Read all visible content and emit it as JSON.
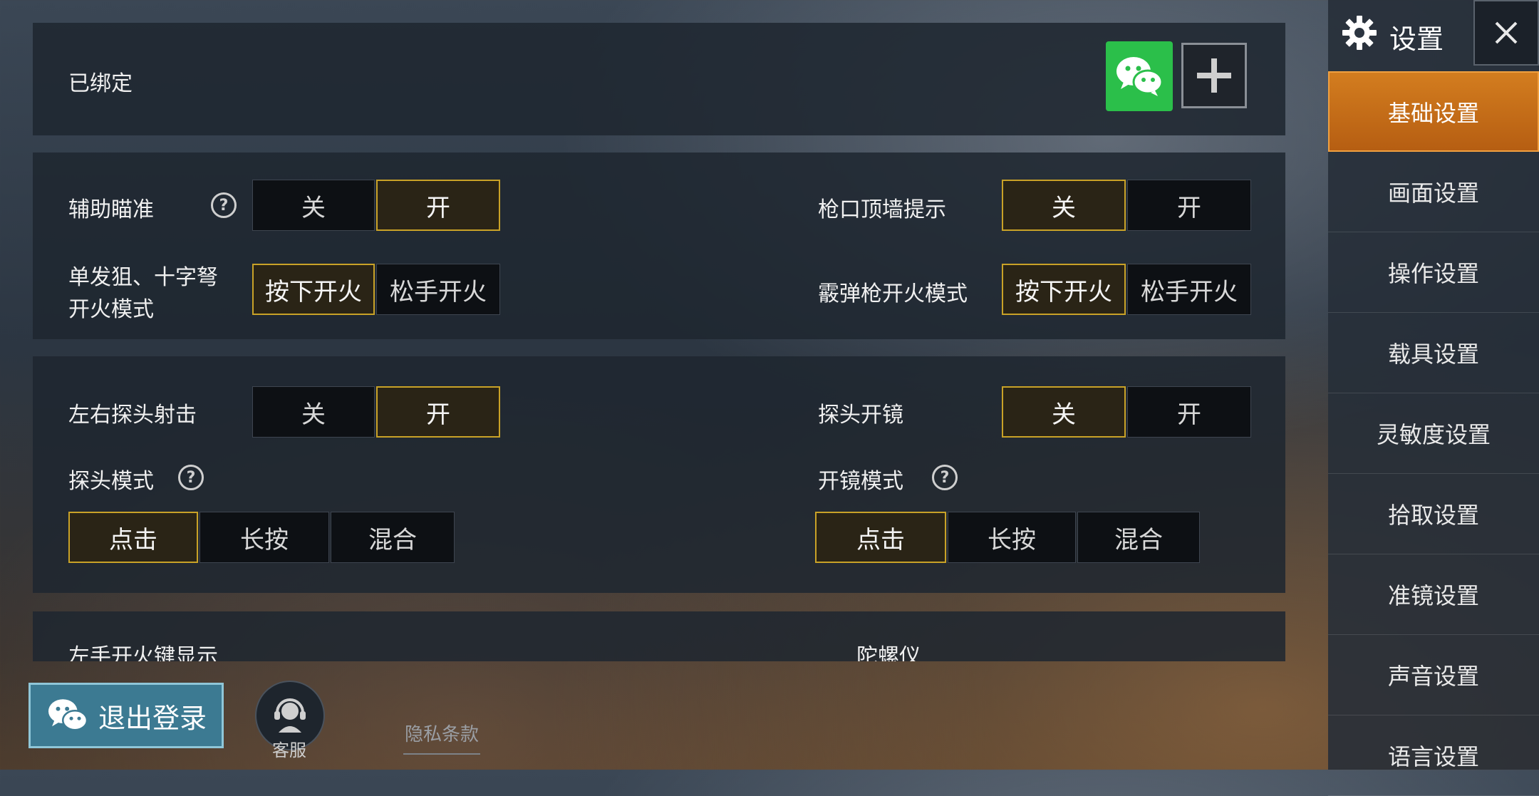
{
  "colors": {
    "accent": "#c9a227",
    "active_tab": "#c46a17",
    "wechat": "#2bbf4a"
  },
  "account": {
    "bound_label": "已绑定",
    "wechat_icon": "wechat-icon",
    "add_icon": "plus-icon"
  },
  "section1": {
    "aim_assist": {
      "label": "辅助瞄准",
      "options": [
        "关",
        "开"
      ],
      "selected": "开"
    },
    "muzzle_wall": {
      "label": "枪口顶墙提示",
      "options": [
        "关",
        "开"
      ],
      "selected": "关"
    },
    "sniper_mode": {
      "label_line1": "单发狙、十字弩",
      "label_line2": "开火模式",
      "options": [
        "按下开火",
        "松手开火"
      ],
      "selected": "按下开火"
    },
    "shotgun_mode": {
      "label": "霰弹枪开火模式",
      "options": [
        "按下开火",
        "松手开火"
      ],
      "selected": "按下开火"
    }
  },
  "section2": {
    "lean_fire": {
      "label": "左右探头射击",
      "options": [
        "关",
        "开"
      ],
      "selected": "开"
    },
    "lean_scope": {
      "label": "探头开镜",
      "options": [
        "关",
        "开"
      ],
      "selected": "关"
    },
    "lean_mode": {
      "label": "探头模式",
      "options": [
        "点击",
        "长按",
        "混合"
      ],
      "selected": "点击"
    },
    "scope_mode": {
      "label": "开镜模式",
      "options": [
        "点击",
        "长按",
        "混合"
      ],
      "selected": "点击"
    }
  },
  "section3": {
    "left_fire": "左手开火键显示",
    "gyro": "陀螺仪"
  },
  "bottom": {
    "logout": "退出登录",
    "service": "客服",
    "privacy": "隐私条款"
  },
  "sidebar": {
    "title": "设置",
    "items": [
      {
        "label": "基础设置",
        "active": true
      },
      {
        "label": "画面设置",
        "active": false
      },
      {
        "label": "操作设置",
        "active": false
      },
      {
        "label": "载具设置",
        "active": false
      },
      {
        "label": "灵敏度设置",
        "active": false
      },
      {
        "label": "拾取设置",
        "active": false
      },
      {
        "label": "准镜设置",
        "active": false
      },
      {
        "label": "声音设置",
        "active": false
      },
      {
        "label": "语言设置",
        "active": false
      }
    ]
  }
}
